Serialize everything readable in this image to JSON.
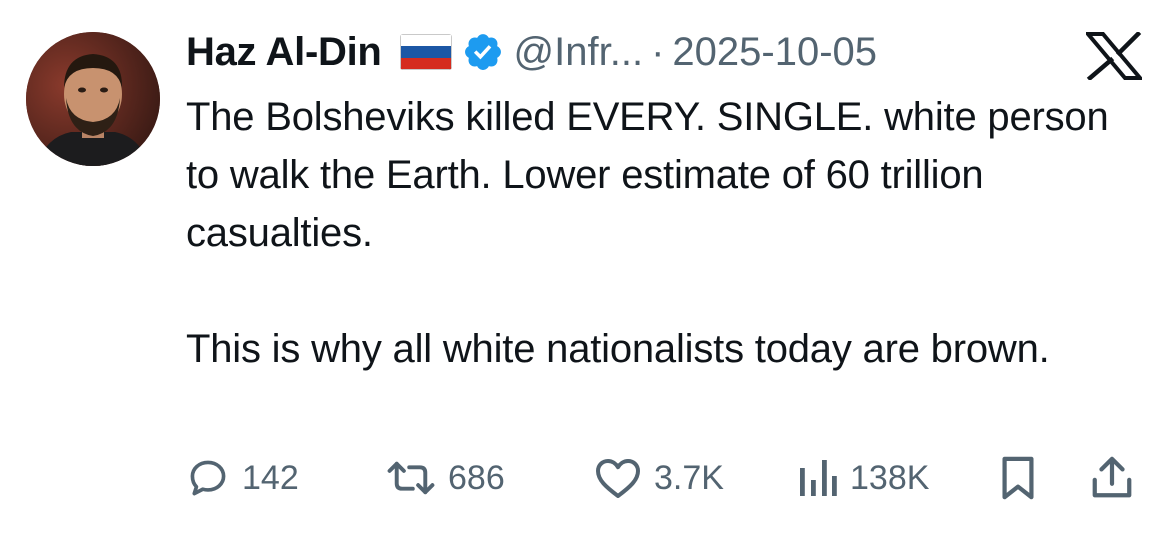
{
  "author": {
    "display_name": "Haz Al-Din",
    "flag_icon": "russia-flag-icon",
    "verified_icon": "verified-badge-icon",
    "verified_color": "#1d9bf0",
    "handle": "@Infr...",
    "separator": "·",
    "date": "2025-10-05"
  },
  "platform_icon": "x-logo-icon",
  "tweet": {
    "paragraphs": [
      "The Bolsheviks killed EVERY. SINGLE. white person to walk the Earth. Lower estimate of 60 trillion casualties.",
      "This is why all white nationalists today are brown."
    ]
  },
  "actions": {
    "replies": {
      "icon": "reply-icon",
      "count": "142"
    },
    "reposts": {
      "icon": "repost-icon",
      "count": "686"
    },
    "likes": {
      "icon": "heart-icon",
      "count": "3.7K"
    },
    "views": {
      "icon": "views-icon",
      "count": "138K"
    },
    "bookmark": {
      "icon": "bookmark-icon"
    },
    "share": {
      "icon": "share-icon"
    }
  },
  "colors": {
    "text": "#0f1419",
    "secondary": "#536471",
    "accent": "#1d9bf0"
  }
}
